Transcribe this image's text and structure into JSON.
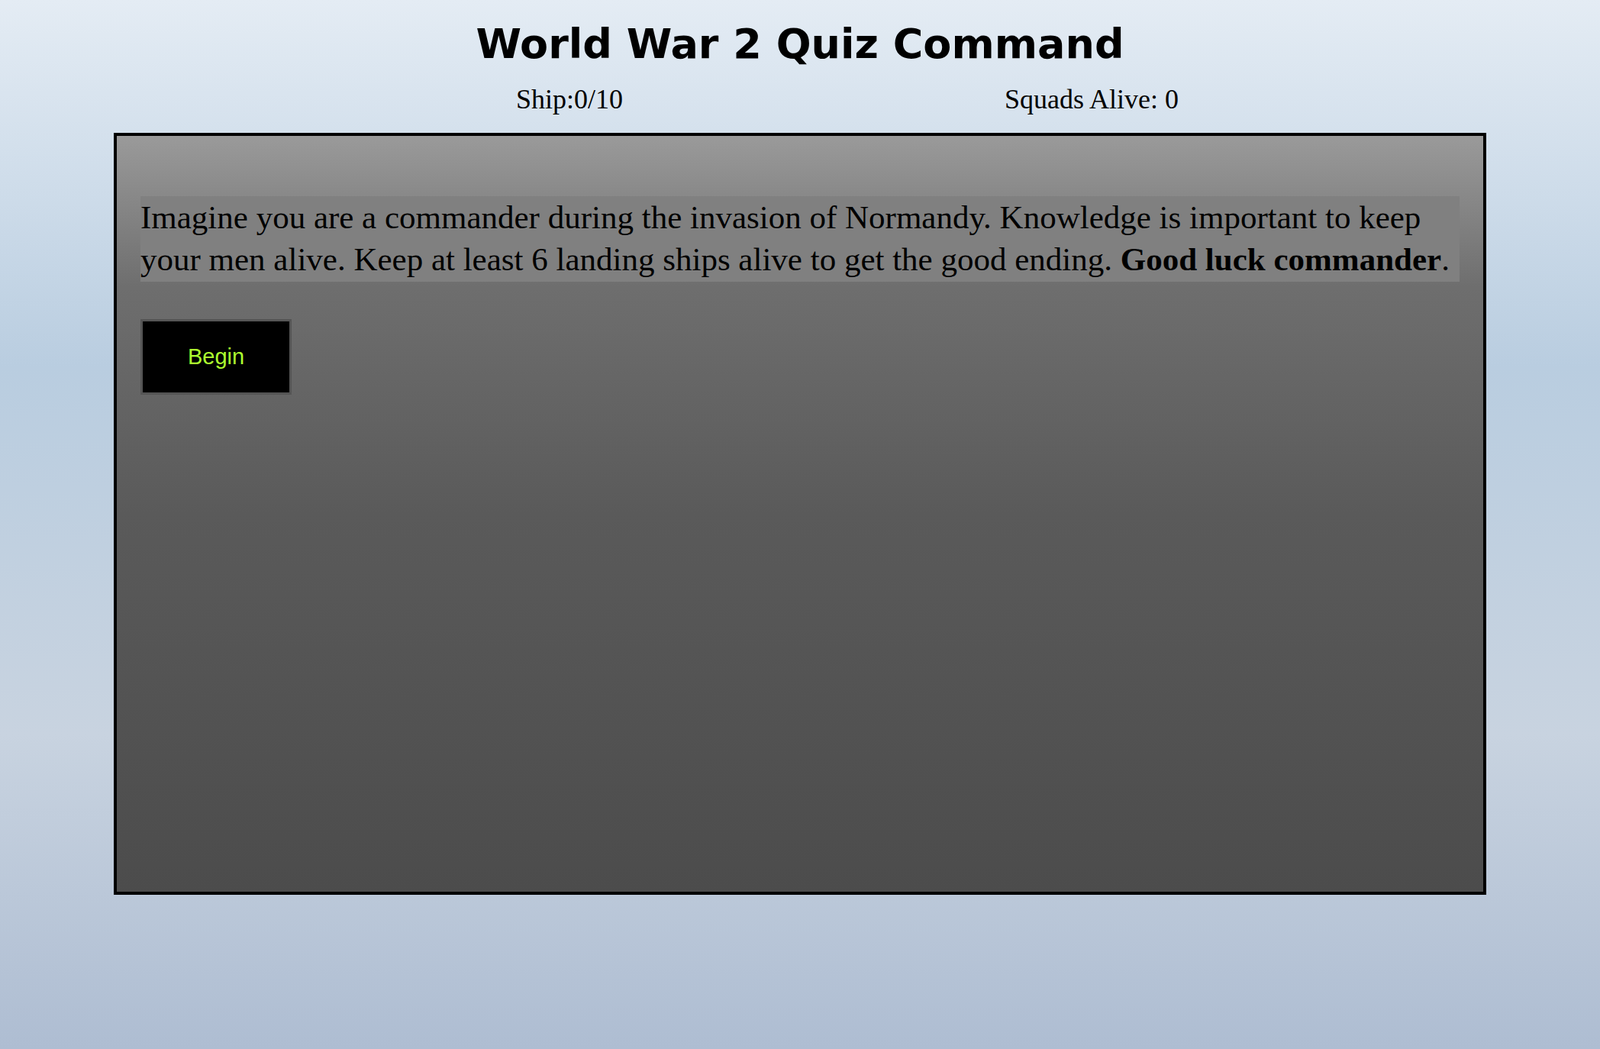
{
  "title": "World War 2 Quiz Command",
  "stats": {
    "ships": "Ship:0/10",
    "squads": "Squads Alive: 0"
  },
  "intro": {
    "text": "Imagine you are a commander during the invasion of Normandy. Knowledge is important to keep your men alive. Keep at least 6 landing ships alive to get the good ending. ",
    "bold": "Good luck commander",
    "end": "."
  },
  "buttons": [
    "Begin"
  ]
}
